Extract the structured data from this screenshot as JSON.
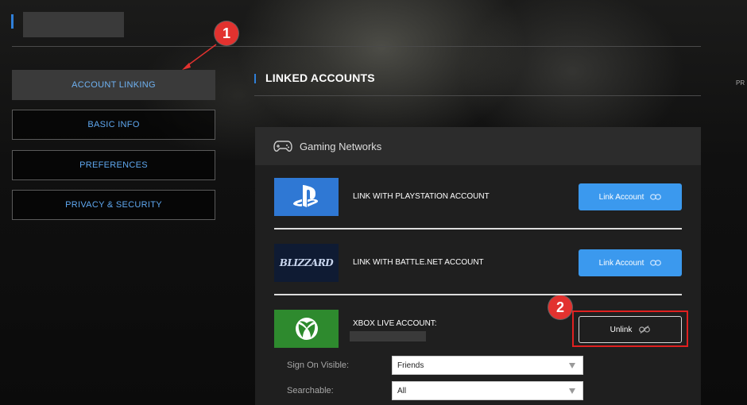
{
  "sidebar": {
    "items": [
      {
        "label": "ACCOUNT LINKING",
        "active": true
      },
      {
        "label": "BASIC INFO",
        "active": false
      },
      {
        "label": "PREFERENCES",
        "active": false
      },
      {
        "label": "PRIVACY & SECURITY",
        "active": false
      }
    ]
  },
  "main": {
    "title": "LINKED ACCOUNTS",
    "edge_text": "PR",
    "panel": {
      "title": "Gaming Networks",
      "accounts": [
        {
          "logo": "playstation-logo",
          "label": "LINK WITH PLAYSTATION ACCOUNT",
          "button": "Link Account"
        },
        {
          "logo": "blizzard-logo",
          "logo_text": "BLIZZARD",
          "label": "LINK WITH BATTLE.NET ACCOUNT",
          "button": "Link Account"
        },
        {
          "logo": "xbox-logo",
          "label": "XBOX LIVE ACCOUNT:",
          "button": "Unlink"
        }
      ],
      "settings": [
        {
          "label": "Sign On Visible:",
          "value": "Friends"
        },
        {
          "label": "Searchable:",
          "value": "All"
        }
      ]
    }
  },
  "annotations": {
    "badge_1": "1",
    "badge_2": "2",
    "color": "#e2322f"
  },
  "colors": {
    "accent": "#3b99ee",
    "nav_text": "#5fa8f0",
    "xbox_green": "#2e8a2e",
    "playstation_blue": "#2f78d4"
  }
}
